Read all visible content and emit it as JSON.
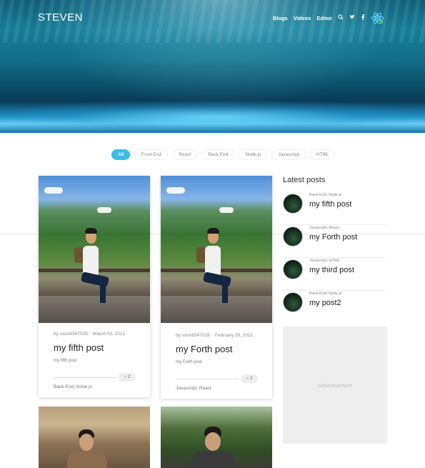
{
  "brand": "STEVEN",
  "nav": {
    "items": [
      "Blogs",
      "Videos",
      "Editor"
    ]
  },
  "filters": [
    "All",
    "Front-End",
    "React",
    "Back-End",
    "Node.js",
    "Javascript",
    "HTML"
  ],
  "cards": [
    {
      "by": "by ssnn8347028",
      "date": "March 02, 2021",
      "title": "my fifth post",
      "excerpt": "my fifth post",
      "comments": "2",
      "tags": "Back-End, Node.js"
    },
    {
      "by": "by ssnn8347028",
      "date": "February 28, 2021",
      "title": "my Forth post",
      "excerpt": "my Forth post",
      "comments": "2",
      "tags": "Javascript, React"
    }
  ],
  "sidebar": {
    "title": "Latest posts",
    "posts": [
      {
        "tags": "Back-End, Node.js",
        "title": "my fifth post"
      },
      {
        "tags": "Javascript, React",
        "title": "my Forth post"
      },
      {
        "tags": "Javascript, HTML",
        "title": "my third post"
      },
      {
        "tags": "Back-End, Node.js",
        "title": "my post2"
      }
    ],
    "ad_label": "Advertisement"
  },
  "colors": {
    "accent": "#3cbce6",
    "ad_bg": "#eeeeee"
  },
  "icons": [
    "search-icon",
    "twitter-icon",
    "facebook-icon",
    "react-logo-icon",
    "comment-icon"
  ]
}
